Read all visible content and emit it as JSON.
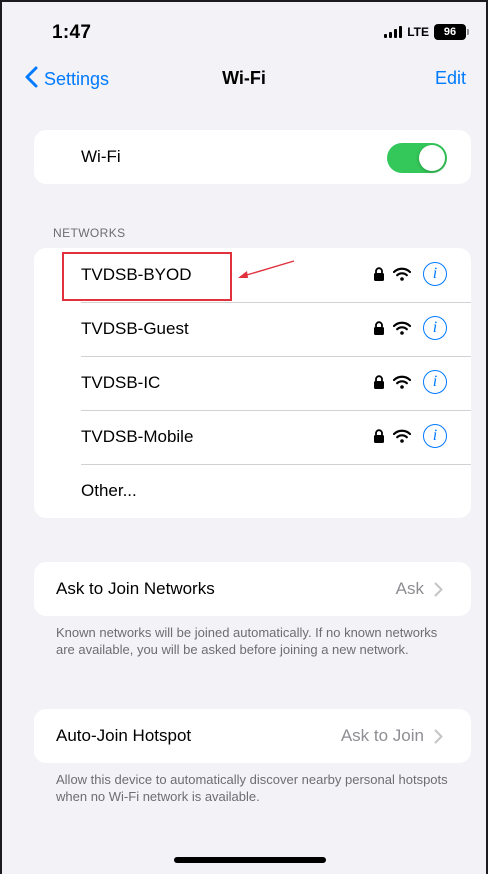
{
  "status_bar": {
    "time": "1:47",
    "carrier": "LTE",
    "battery": "96"
  },
  "nav": {
    "back_label": "Settings",
    "title": "Wi-Fi",
    "edit_label": "Edit"
  },
  "wifi_toggle": {
    "label": "Wi-Fi",
    "enabled": true,
    "on_color": "#34c759"
  },
  "networks": {
    "header": "NETWORKS",
    "items": [
      {
        "name": "TVDSB-BYOD",
        "secured": true,
        "icons": [
          "lock-icon",
          "wifi-icon",
          "info-icon"
        ]
      },
      {
        "name": "TVDSB-Guest",
        "secured": true,
        "icons": [
          "lock-icon",
          "wifi-icon",
          "info-icon"
        ]
      },
      {
        "name": "TVDSB-IC",
        "secured": true,
        "icons": [
          "lock-icon",
          "wifi-icon",
          "info-icon"
        ]
      },
      {
        "name": "TVDSB-Mobile",
        "secured": true,
        "icons": [
          "lock-icon",
          "wifi-icon",
          "info-icon"
        ]
      }
    ],
    "other_label": "Other...",
    "info_glyph": "i"
  },
  "ask_to_join": {
    "label": "Ask to Join Networks",
    "value": "Ask",
    "footnote": "Known networks will be joined automatically. If no known networks are available, you will be asked before joining a new network."
  },
  "auto_join": {
    "label": "Auto-Join Hotspot",
    "value": "Ask to Join",
    "footnote": "Allow this device to automatically discover nearby personal hotspots when no Wi-Fi network is available."
  },
  "colors": {
    "accent": "#007aff",
    "annotation": "#e0313c",
    "background": "#f2f2f7"
  }
}
